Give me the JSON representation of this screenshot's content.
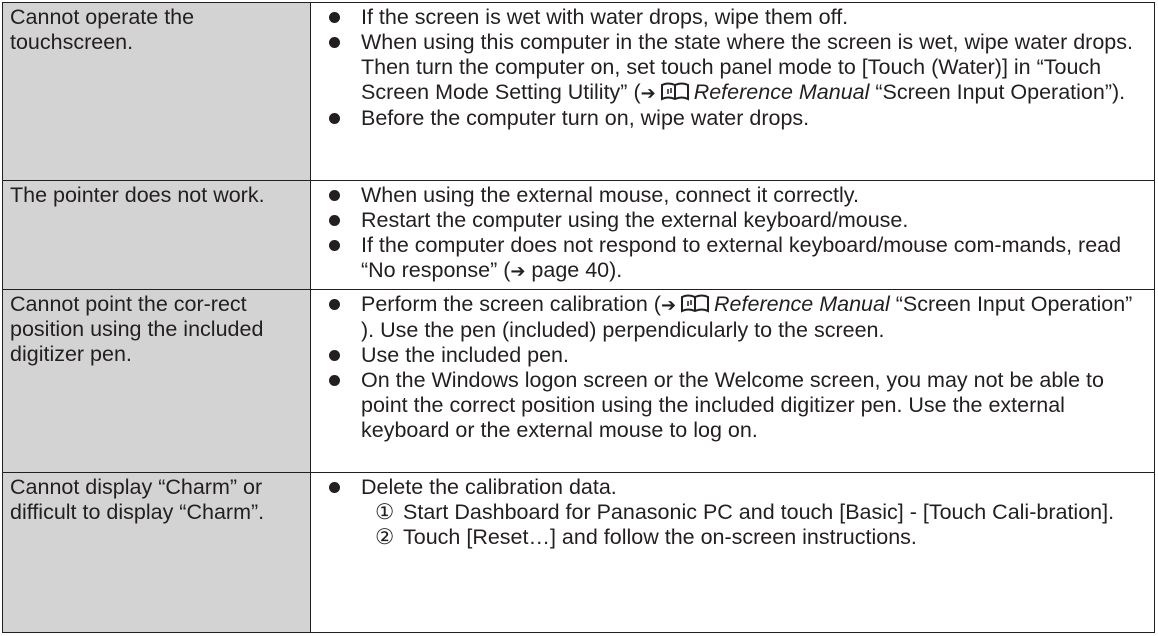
{
  "rows": [
    {
      "problem": "Cannot operate the touchscreen.",
      "items": [
        {
          "text": "If the screen is wet with water drops, wipe them off."
        },
        {
          "pre": "When using this computer in the state where the screen is wet, wipe water drops. Then turn the computer on, set touch panel mode to [Touch (Water)] in “Touch Screen Mode Setting Utility” (",
          "arrow": "➔",
          "icon": "reference-manual-book-icon",
          "ref": "Reference Manual",
          "post": " “Screen Input Operation”)."
        },
        {
          "text": "Before the computer turn on, wipe water drops."
        }
      ]
    },
    {
      "problem": "The pointer does not work.",
      "items": [
        {
          "text": "When using the external mouse, connect it correctly."
        },
        {
          "text": "Restart the computer using the external keyboard/mouse."
        },
        {
          "pre": "If the computer does not respond to external keyboard/mouse com-mands, read “No response” (",
          "arrow": "➔",
          "post": " page 40)."
        }
      ]
    },
    {
      "problem": "Cannot point the cor-rect position using the included digitizer pen.",
      "items": [
        {
          "pre": "Perform the screen calibration (",
          "arrow": "➔",
          "icon": "reference-manual-book-icon",
          "ref": "Reference Manual",
          "post": " “Screen Input Operation” ). Use the pen (included) perpendicularly to the screen."
        },
        {
          "text": "Use the included pen."
        },
        {
          "text": "On the Windows logon screen or the Welcome screen, you may not be able to point the correct position using the included digitizer pen. Use the external keyboard or the external mouse to log on."
        }
      ]
    },
    {
      "problem": "Cannot display “Charm” or difficult to display “Charm”.",
      "items": [
        {
          "text": "Delete the calibration data."
        }
      ],
      "steps": [
        {
          "num": "①",
          "text": "Start Dashboard for Panasonic PC and touch [Basic] - [Touch Cali-bration]."
        },
        {
          "num": "②",
          "text": "Touch [Reset…] and follow the on-screen instructions."
        }
      ]
    }
  ]
}
